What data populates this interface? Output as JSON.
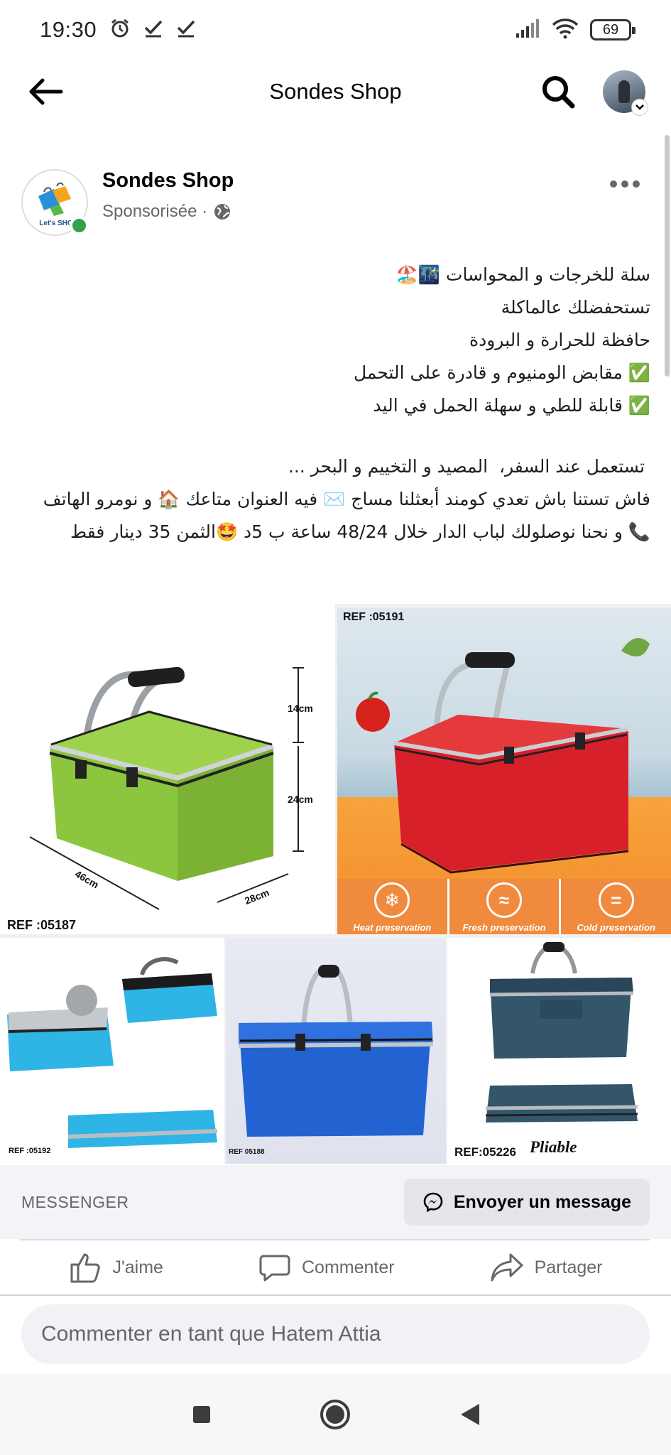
{
  "status_bar": {
    "time": "19:30",
    "battery": "69",
    "icons": [
      "alarm-icon",
      "check-icon",
      "check-icon",
      "signal-icon",
      "wifi-icon",
      "battery-icon"
    ]
  },
  "header": {
    "title": "Sondes Shop",
    "back_icon": "arrow-left-icon",
    "search_icon": "search-icon"
  },
  "post": {
    "page_name": "Sondes Shop",
    "meta": "Sponsorisée ·",
    "privacy_icon": "globe-icon",
    "logo_text": "Let's SHO",
    "text_lines": [
      "سلة للخرجات و المحواسات 🌃🏖️",
      "تستحفضلك عالماكلة",
      "حافظة للحرارة و البرودة",
      "✅ مقابض الومنيوم و قادرة على التحمل",
      "✅ قابلة للطي و سهلة الحمل في اليد",
      "",
      " تستعمل عند السفر،  المصيد و التخييم و البحر ...",
      "فاش تستنا باش تعدي كومند أبعثلنا مساج ✉️ فيه العنوان متاعك 🏠 و نومرو الهاتف 📞 و نحنا نوصلولك لباب الدار خلال 48/24 ساعة ب 5د 🤩الثمن 35 دينار فقط"
    ]
  },
  "photos": {
    "green": {
      "ref": "REF :05187",
      "dim_height1": "14cm",
      "dim_height2": "24cm",
      "dim_length": "46cm",
      "dim_width": "28cm",
      "color": "#8cc63f"
    },
    "red": {
      "ref": "REF :05191",
      "color": "#d8202a",
      "features": [
        "Heat preservation",
        "Fresh preservation",
        "Cold preservation"
      ]
    },
    "light_blue": {
      "ref": "REF :05192",
      "color": "#2fb4e6"
    },
    "blue": {
      "ref": "REF 05188",
      "color": "#2363d1"
    },
    "navy": {
      "ref": "REF:05226",
      "pliable": "Pliable",
      "color": "#34566b"
    }
  },
  "messenger": {
    "label": "MESSENGER",
    "button": "Envoyer un message"
  },
  "actions": {
    "like": "J'aime",
    "comment": "Commenter",
    "share": "Partager"
  },
  "comment": {
    "placeholder": "Commenter en tant que Hatem Attia"
  }
}
